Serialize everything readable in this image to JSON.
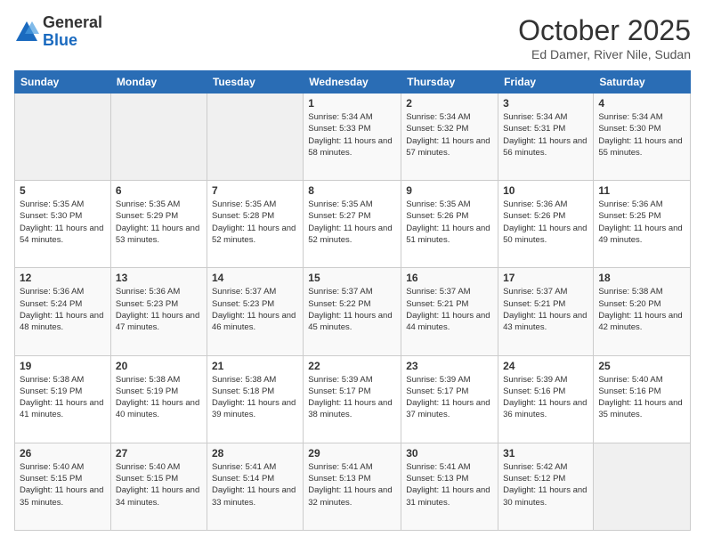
{
  "logo": {
    "general": "General",
    "blue": "Blue"
  },
  "header": {
    "title": "October 2025",
    "subtitle": "Ed Damer, River Nile, Sudan"
  },
  "weekdays": [
    "Sunday",
    "Monday",
    "Tuesday",
    "Wednesday",
    "Thursday",
    "Friday",
    "Saturday"
  ],
  "weeks": [
    [
      {
        "day": "",
        "sunrise": "",
        "sunset": "",
        "daylight": ""
      },
      {
        "day": "",
        "sunrise": "",
        "sunset": "",
        "daylight": ""
      },
      {
        "day": "",
        "sunrise": "",
        "sunset": "",
        "daylight": ""
      },
      {
        "day": "1",
        "sunrise": "Sunrise: 5:34 AM",
        "sunset": "Sunset: 5:33 PM",
        "daylight": "Daylight: 11 hours and 58 minutes."
      },
      {
        "day": "2",
        "sunrise": "Sunrise: 5:34 AM",
        "sunset": "Sunset: 5:32 PM",
        "daylight": "Daylight: 11 hours and 57 minutes."
      },
      {
        "day": "3",
        "sunrise": "Sunrise: 5:34 AM",
        "sunset": "Sunset: 5:31 PM",
        "daylight": "Daylight: 11 hours and 56 minutes."
      },
      {
        "day": "4",
        "sunrise": "Sunrise: 5:34 AM",
        "sunset": "Sunset: 5:30 PM",
        "daylight": "Daylight: 11 hours and 55 minutes."
      }
    ],
    [
      {
        "day": "5",
        "sunrise": "Sunrise: 5:35 AM",
        "sunset": "Sunset: 5:30 PM",
        "daylight": "Daylight: 11 hours and 54 minutes."
      },
      {
        "day": "6",
        "sunrise": "Sunrise: 5:35 AM",
        "sunset": "Sunset: 5:29 PM",
        "daylight": "Daylight: 11 hours and 53 minutes."
      },
      {
        "day": "7",
        "sunrise": "Sunrise: 5:35 AM",
        "sunset": "Sunset: 5:28 PM",
        "daylight": "Daylight: 11 hours and 52 minutes."
      },
      {
        "day": "8",
        "sunrise": "Sunrise: 5:35 AM",
        "sunset": "Sunset: 5:27 PM",
        "daylight": "Daylight: 11 hours and 52 minutes."
      },
      {
        "day": "9",
        "sunrise": "Sunrise: 5:35 AM",
        "sunset": "Sunset: 5:26 PM",
        "daylight": "Daylight: 11 hours and 51 minutes."
      },
      {
        "day": "10",
        "sunrise": "Sunrise: 5:36 AM",
        "sunset": "Sunset: 5:26 PM",
        "daylight": "Daylight: 11 hours and 50 minutes."
      },
      {
        "day": "11",
        "sunrise": "Sunrise: 5:36 AM",
        "sunset": "Sunset: 5:25 PM",
        "daylight": "Daylight: 11 hours and 49 minutes."
      }
    ],
    [
      {
        "day": "12",
        "sunrise": "Sunrise: 5:36 AM",
        "sunset": "Sunset: 5:24 PM",
        "daylight": "Daylight: 11 hours and 48 minutes."
      },
      {
        "day": "13",
        "sunrise": "Sunrise: 5:36 AM",
        "sunset": "Sunset: 5:23 PM",
        "daylight": "Daylight: 11 hours and 47 minutes."
      },
      {
        "day": "14",
        "sunrise": "Sunrise: 5:37 AM",
        "sunset": "Sunset: 5:23 PM",
        "daylight": "Daylight: 11 hours and 46 minutes."
      },
      {
        "day": "15",
        "sunrise": "Sunrise: 5:37 AM",
        "sunset": "Sunset: 5:22 PM",
        "daylight": "Daylight: 11 hours and 45 minutes."
      },
      {
        "day": "16",
        "sunrise": "Sunrise: 5:37 AM",
        "sunset": "Sunset: 5:21 PM",
        "daylight": "Daylight: 11 hours and 44 minutes."
      },
      {
        "day": "17",
        "sunrise": "Sunrise: 5:37 AM",
        "sunset": "Sunset: 5:21 PM",
        "daylight": "Daylight: 11 hours and 43 minutes."
      },
      {
        "day": "18",
        "sunrise": "Sunrise: 5:38 AM",
        "sunset": "Sunset: 5:20 PM",
        "daylight": "Daylight: 11 hours and 42 minutes."
      }
    ],
    [
      {
        "day": "19",
        "sunrise": "Sunrise: 5:38 AM",
        "sunset": "Sunset: 5:19 PM",
        "daylight": "Daylight: 11 hours and 41 minutes."
      },
      {
        "day": "20",
        "sunrise": "Sunrise: 5:38 AM",
        "sunset": "Sunset: 5:19 PM",
        "daylight": "Daylight: 11 hours and 40 minutes."
      },
      {
        "day": "21",
        "sunrise": "Sunrise: 5:38 AM",
        "sunset": "Sunset: 5:18 PM",
        "daylight": "Daylight: 11 hours and 39 minutes."
      },
      {
        "day": "22",
        "sunrise": "Sunrise: 5:39 AM",
        "sunset": "Sunset: 5:17 PM",
        "daylight": "Daylight: 11 hours and 38 minutes."
      },
      {
        "day": "23",
        "sunrise": "Sunrise: 5:39 AM",
        "sunset": "Sunset: 5:17 PM",
        "daylight": "Daylight: 11 hours and 37 minutes."
      },
      {
        "day": "24",
        "sunrise": "Sunrise: 5:39 AM",
        "sunset": "Sunset: 5:16 PM",
        "daylight": "Daylight: 11 hours and 36 minutes."
      },
      {
        "day": "25",
        "sunrise": "Sunrise: 5:40 AM",
        "sunset": "Sunset: 5:16 PM",
        "daylight": "Daylight: 11 hours and 35 minutes."
      }
    ],
    [
      {
        "day": "26",
        "sunrise": "Sunrise: 5:40 AM",
        "sunset": "Sunset: 5:15 PM",
        "daylight": "Daylight: 11 hours and 35 minutes."
      },
      {
        "day": "27",
        "sunrise": "Sunrise: 5:40 AM",
        "sunset": "Sunset: 5:15 PM",
        "daylight": "Daylight: 11 hours and 34 minutes."
      },
      {
        "day": "28",
        "sunrise": "Sunrise: 5:41 AM",
        "sunset": "Sunset: 5:14 PM",
        "daylight": "Daylight: 11 hours and 33 minutes."
      },
      {
        "day": "29",
        "sunrise": "Sunrise: 5:41 AM",
        "sunset": "Sunset: 5:13 PM",
        "daylight": "Daylight: 11 hours and 32 minutes."
      },
      {
        "day": "30",
        "sunrise": "Sunrise: 5:41 AM",
        "sunset": "Sunset: 5:13 PM",
        "daylight": "Daylight: 11 hours and 31 minutes."
      },
      {
        "day": "31",
        "sunrise": "Sunrise: 5:42 AM",
        "sunset": "Sunset: 5:12 PM",
        "daylight": "Daylight: 11 hours and 30 minutes."
      },
      {
        "day": "",
        "sunrise": "",
        "sunset": "",
        "daylight": ""
      }
    ]
  ]
}
